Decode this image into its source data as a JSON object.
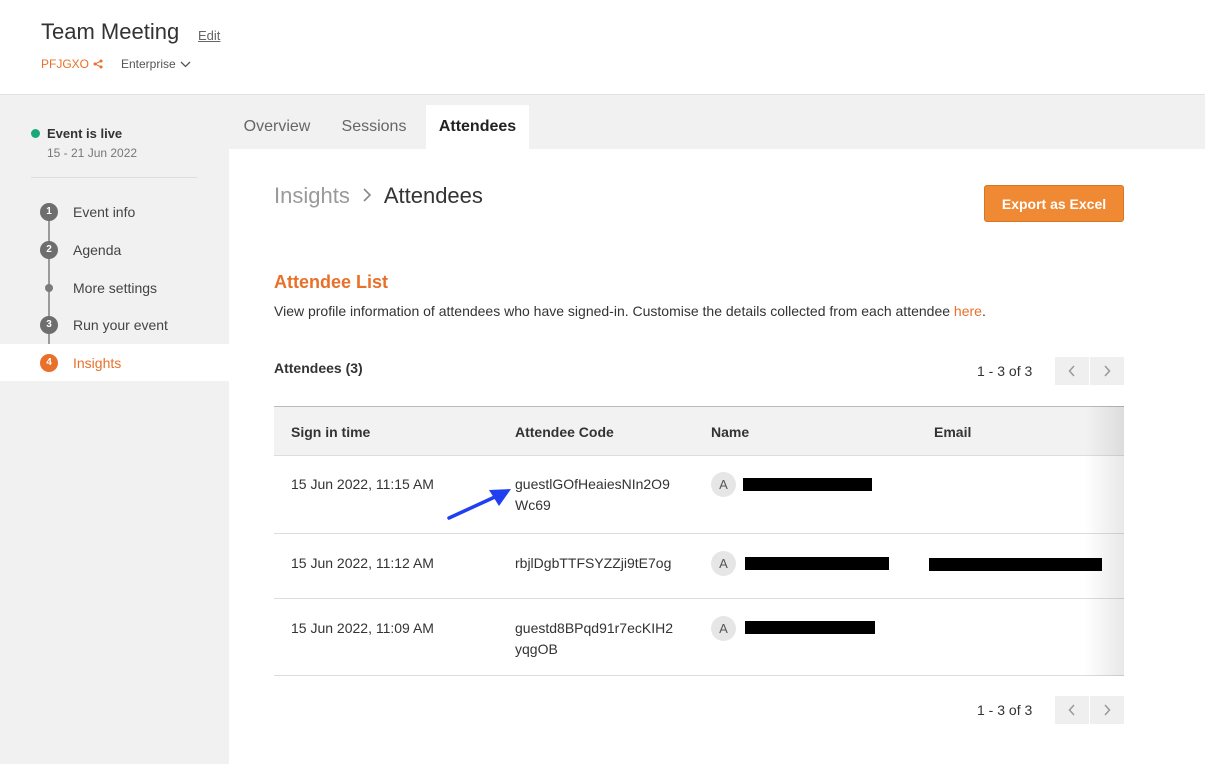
{
  "header": {
    "title": "Team Meeting",
    "edit_label": "Edit",
    "event_code": "PFJGXO",
    "plan_label": "Enterprise"
  },
  "sidebar": {
    "status": "Event is live",
    "dates": "15 - 21 Jun 2022",
    "steps": [
      {
        "badge": "1",
        "label": "Event info"
      },
      {
        "badge": "2",
        "label": "Agenda"
      },
      {
        "badge": "",
        "label": "More settings"
      },
      {
        "badge": "3",
        "label": "Run your event"
      },
      {
        "badge": "4",
        "label": "Insights"
      }
    ],
    "active_step": "Insights"
  },
  "tabs": [
    {
      "label": "Overview"
    },
    {
      "label": "Sessions"
    },
    {
      "label": "Attendees"
    }
  ],
  "active_tab": "Attendees",
  "breadcrumb": {
    "parent": "Insights",
    "separator": ">",
    "current": "Attendees"
  },
  "export_label": "Export as Excel",
  "attendee_list": {
    "title": "Attendee List",
    "description": "View profile information of attendees who have signed-in. Customise the details collected from each attendee ",
    "link_label": "here",
    "link_suffix": "."
  },
  "attendees_count_label": "Attendees (3)",
  "pagination": {
    "top_label": "1 - 3 of 3",
    "bottom_label": "1 - 3 of 3"
  },
  "table": {
    "columns": [
      "Sign in time",
      "Attendee Code",
      "Name",
      "Email"
    ],
    "rows": [
      {
        "time": "15 Jun 2022, 11:15 AM",
        "code_line1": "guestlGOfHeaiesNIn2O9",
        "code_line2": "Wc69",
        "avatar": "A"
      },
      {
        "time": "15 Jun 2022, 11:12 AM",
        "code_line1": "rbjlDgbTTFSYZZji9tE7og",
        "code_line2": "",
        "avatar": "A"
      },
      {
        "time": "15 Jun 2022, 11:09 AM",
        "code_line1": "guestd8BPqd91r7ecKIH2",
        "code_line2": "yqgOB",
        "avatar": "A"
      }
    ]
  },
  "colors": {
    "accent": "#e8702a",
    "live": "#1aa77a",
    "annotation_arrow": "#1f3ff0"
  }
}
